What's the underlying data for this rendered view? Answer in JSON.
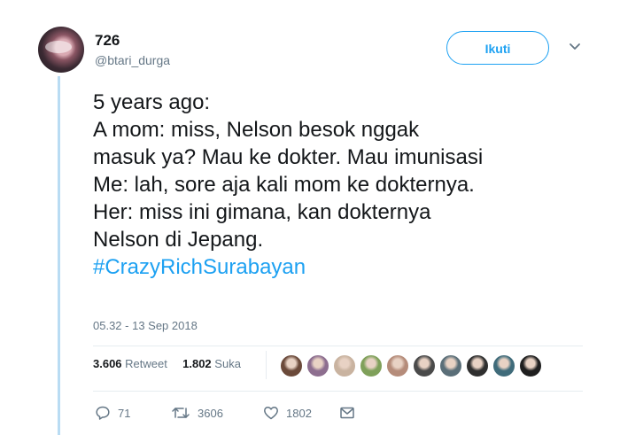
{
  "user": {
    "display_name": "726",
    "handle": "@btari_durga",
    "follow_label": "Ikuti"
  },
  "tweet": {
    "lines": [
      "5 years ago:",
      "A mom: miss, Nelson besok nggak",
      "masuk ya? Mau ke dokter. Mau imunisasi",
      "Me: lah, sore aja kali mom ke dokternya.",
      "Her: miss ini gimana, kan dokternya",
      "Nelson di Jepang."
    ],
    "hashtag": "#CrazyRichSurabayan",
    "timestamp": "05.32 - 13 Sep 2018"
  },
  "stats": {
    "retweets": "3.606",
    "retweets_label": "Retweet",
    "likes": "1.802",
    "likes_label": "Suka"
  },
  "likers": [
    {
      "icon": "liker-avatar-1",
      "color": "#6b4a3a"
    },
    {
      "icon": "liker-avatar-2",
      "color": "#8d6e8f"
    },
    {
      "icon": "liker-avatar-3",
      "color": "#c9b3a0"
    },
    {
      "icon": "liker-avatar-4",
      "color": "#7fa05a"
    },
    {
      "icon": "liker-avatar-5",
      "color": "#b58c7a"
    },
    {
      "icon": "liker-avatar-6",
      "color": "#4a4a4a"
    },
    {
      "icon": "liker-avatar-7",
      "color": "#5a6e78"
    },
    {
      "icon": "liker-avatar-8",
      "color": "#2f2f2f"
    },
    {
      "icon": "liker-avatar-9",
      "color": "#3f6b7a"
    },
    {
      "icon": "liker-avatar-10",
      "color": "#1f1f1f"
    }
  ],
  "actions": {
    "replies": "71",
    "retweets": "3606",
    "likes": "1802"
  },
  "colors": {
    "accent": "#1da1f2",
    "thread_line": "#b9dcf3",
    "muted": "#657786"
  }
}
